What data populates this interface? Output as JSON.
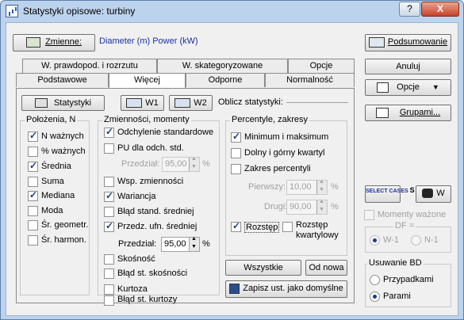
{
  "window": {
    "title": "Statystyki opisowe: turbiny",
    "help": "?",
    "close": "X"
  },
  "top": {
    "variables_btn": "Zmienne:",
    "variables_value": "Diameter (m) Power (kW)"
  },
  "tabs_row1": [
    "W. prawdopod. i rozrzutu",
    "W. skategoryzowane",
    "Opcje"
  ],
  "tabs_row2": [
    "Podstawowe",
    "Więcej",
    "Odporne",
    "Normalność"
  ],
  "toolbar": {
    "stats": "Statystyki",
    "w1": "W1",
    "w2": "W2",
    "compute_label": "Oblicz statystyki:"
  },
  "polozenia": {
    "title": "Położenia, N",
    "items": [
      {
        "label": "N ważnych",
        "checked": true
      },
      {
        "label": "% ważnych",
        "checked": false
      },
      {
        "label": "Średnia",
        "checked": true
      },
      {
        "label": "Suma",
        "checked": false
      },
      {
        "label": "Mediana",
        "checked": true
      },
      {
        "label": "Moda",
        "checked": false
      },
      {
        "label": "Śr. geometr.",
        "checked": false
      },
      {
        "label": "Śr. harmon.",
        "checked": false
      }
    ]
  },
  "zmiennosci": {
    "title": "Zmienności, momenty",
    "odch": "Odchylenie standardowe",
    "pu": "PU dla odch. std.",
    "przedzial1_label": "Przedział:",
    "przedzial1_value": "95,00",
    "pct": "%",
    "wsp": "Wsp. zmienności",
    "wariancja": "Wariancja",
    "blad_sr": "Błąd stand. średniej",
    "przedz_ufn": "Przedz. ufn. średniej",
    "przedzial2_label": "Przedział:",
    "przedzial2_value": "95,00",
    "skosnosc": "Skośność",
    "blad_sk": "Błąd st. skośności",
    "kurtoza": "Kurtoza",
    "blad_ku": "Błąd st. kurtozy"
  },
  "percentyle": {
    "title": "Percentyle, zakresy",
    "minmax": "Minimum i maksimum",
    "kwartyl": "Dolny i górny kwartyl",
    "zakres": "Zakres percentyli",
    "pierwszy_label": "Pierwszy:",
    "pierwszy_value": "10,00",
    "drugi_label": "Drugi:",
    "drugi_value": "90,00",
    "rozstep": "Rozstęp",
    "rozstep_kw1": "Rozstęp",
    "rozstep_kw2": "kwartylowy"
  },
  "actions": {
    "wszystkie": "Wszystkie",
    "od_nowa": "Od nowa",
    "zapisz": "Zapisz ust. jako domyślne"
  },
  "right": {
    "podsumowanie": "Podsumowanie",
    "anuluj": "Anuluj",
    "opcje": "Opcje",
    "grupami": "Grupami...",
    "select_cases": "SELECT CASES",
    "s": "S",
    "w": "W",
    "momenty": "Momenty ważone",
    "df": "DF =",
    "w1": "W-1",
    "n1": "N-1",
    "usuwanie_title": "Usuwanie BD",
    "przypadkami": "Przypadkami",
    "parami": "Parami"
  }
}
